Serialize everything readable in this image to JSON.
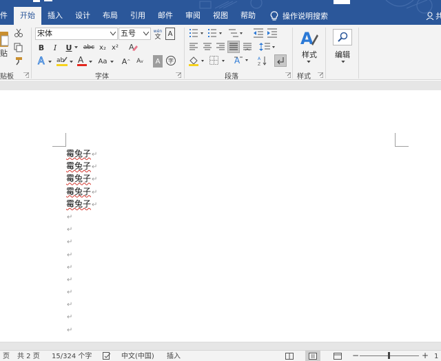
{
  "tabs": [
    {
      "label": "件",
      "active": false
    },
    {
      "label": "开始",
      "active": true
    },
    {
      "label": "插入",
      "active": false
    },
    {
      "label": "设计",
      "active": false
    },
    {
      "label": "布局",
      "active": false
    },
    {
      "label": "引用",
      "active": false
    },
    {
      "label": "邮件",
      "active": false
    },
    {
      "label": "审阅",
      "active": false
    },
    {
      "label": "视图",
      "active": false
    },
    {
      "label": "帮助",
      "active": false
    }
  ],
  "tell_me": {
    "label": "操作说明搜索",
    "icon": "lightbulb-icon"
  },
  "account": {
    "label": "共",
    "icon": "person-icon"
  },
  "clipboard": {
    "paste_label": "贴",
    "group_label": "贴板"
  },
  "font": {
    "name": "宋体",
    "size": "五号",
    "group_label": "字体",
    "bold": "B",
    "italic": "I",
    "underline": "U",
    "strike": "abc",
    "subscript": "x₂",
    "superscript": "x²",
    "change_case": "Aa",
    "grow": "A",
    "shrink": "A",
    "char_shading": "A",
    "enclose": "字",
    "phonetic_top": "wén",
    "phonetic_bottom": "文",
    "border": "A",
    "font_color": "A",
    "highlight": "ab",
    "text_effect": "A"
  },
  "paragraph": {
    "group_label": "段落"
  },
  "styles": {
    "label": "样式",
    "group_label": "样式"
  },
  "editing": {
    "label": "编辑"
  },
  "document": {
    "lines": [
      {
        "text": "霉兔子",
        "spell_error": true
      },
      {
        "text": "霉兔子",
        "spell_error": true
      },
      {
        "text": "霉兔子",
        "spell_error": true
      },
      {
        "text": "霉兔子",
        "spell_error": true
      },
      {
        "text": "霉兔子",
        "spell_error": true
      },
      {
        "text": "",
        "spell_error": false
      },
      {
        "text": "",
        "spell_error": false
      },
      {
        "text": "",
        "spell_error": false
      },
      {
        "text": "",
        "spell_error": false
      },
      {
        "text": "",
        "spell_error": false
      },
      {
        "text": "",
        "spell_error": false
      },
      {
        "text": "",
        "spell_error": false
      },
      {
        "text": "",
        "spell_error": false
      },
      {
        "text": "",
        "spell_error": false
      },
      {
        "text": "",
        "spell_error": false
      }
    ],
    "paragraph_mark": "↵"
  },
  "status": {
    "page": "页",
    "total_pages": "共 2 页",
    "word_count": "15/324 个字",
    "language": "中文(中国)",
    "mode": "插入",
    "zoom_minus": "−",
    "zoom_plus": "+",
    "zoom_value": "1"
  },
  "colors": {
    "accent": "#2b579a",
    "ribbon_bg": "#f3f3f3",
    "font_color_bar": "#e2261d",
    "highlight_bar": "#f6d21e",
    "spell_underline": "#d2332b"
  }
}
